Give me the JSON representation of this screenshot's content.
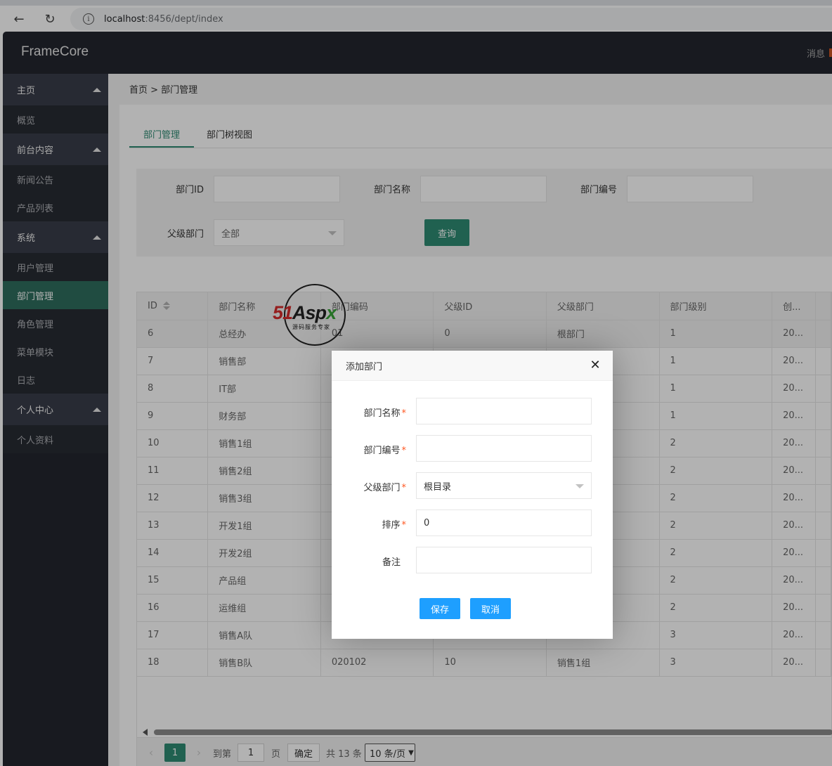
{
  "browser": {
    "url_host": "localhost",
    "url_path": ":8456/dept/index"
  },
  "header": {
    "logo": "FrameCore",
    "message": "消息"
  },
  "sidebar": {
    "groups": [
      {
        "label": "主页",
        "items": [
          "概览"
        ]
      },
      {
        "label": "前台内容",
        "items": [
          "新闻公告",
          "产品列表"
        ]
      },
      {
        "label": "系统",
        "items": [
          "用户管理",
          "部门管理",
          "角色管理",
          "菜单模块",
          "日志"
        ]
      },
      {
        "label": "个人中心",
        "items": [
          "个人资料"
        ]
      }
    ],
    "active_item": "部门管理"
  },
  "breadcrumb": "首页 > 部门管理",
  "tabs": [
    "部门管理",
    "部门树视图"
  ],
  "filter": {
    "dept_id_label": "部门ID",
    "dept_name_label": "部门名称",
    "dept_code_label": "部门编号",
    "parent_label": "父级部门",
    "parent_value": "全部",
    "query_button": "查询"
  },
  "table": {
    "columns": [
      "ID",
      "部门名称",
      "部门编码",
      "父级ID",
      "父级部门",
      "部门级别",
      "创..."
    ],
    "rows": [
      [
        "6",
        "总经办",
        "01",
        "0",
        "根部门",
        "1",
        "20..."
      ],
      [
        "7",
        "销售部",
        "",
        "",
        "",
        "1",
        "20..."
      ],
      [
        "8",
        "IT部",
        "",
        "",
        "",
        "1",
        "20..."
      ],
      [
        "9",
        "财务部",
        "",
        "",
        "",
        "1",
        "20..."
      ],
      [
        "10",
        "销售1组",
        "",
        "",
        "",
        "2",
        "20..."
      ],
      [
        "11",
        "销售2组",
        "",
        "",
        "",
        "2",
        "20..."
      ],
      [
        "12",
        "销售3组",
        "",
        "",
        "",
        "2",
        "20..."
      ],
      [
        "13",
        "开发1组",
        "",
        "",
        "",
        "2",
        "20..."
      ],
      [
        "14",
        "开发2组",
        "",
        "",
        "",
        "2",
        "20..."
      ],
      [
        "15",
        "产品组",
        "",
        "",
        "",
        "2",
        "20..."
      ],
      [
        "16",
        "运维组",
        "",
        "",
        "",
        "2",
        "20..."
      ],
      [
        "17",
        "销售A队",
        "",
        "",
        "",
        "3",
        "20..."
      ],
      [
        "18",
        "销售B队",
        "020102",
        "10",
        "销售1组",
        "3",
        "20..."
      ]
    ]
  },
  "pager": {
    "current": "1",
    "goto_label": "到第",
    "goto_value": "1",
    "page_label": "页",
    "confirm": "确定",
    "total": "共 13 条",
    "page_size": "10 条/页"
  },
  "watermark": {
    "brand_51": "51",
    "brand_asp": "Asp",
    "brand_x": "x",
    "tagline": "源码服务专家"
  },
  "dialog": {
    "title": "添加部门",
    "fields": [
      {
        "label": "部门名称",
        "required": true,
        "value": ""
      },
      {
        "label": "部门编号",
        "required": true,
        "value": ""
      },
      {
        "label": "父级部门",
        "required": true,
        "value": "根目录"
      },
      {
        "label": "排序",
        "required": true,
        "value": "0"
      },
      {
        "label": "备注",
        "required": false,
        "value": ""
      }
    ],
    "save_button": "保存",
    "cancel_button": "取消"
  },
  "colors": {
    "accent": "#2f8b73",
    "header_bg": "#23262e",
    "dialog_button": "#1e9fff"
  }
}
